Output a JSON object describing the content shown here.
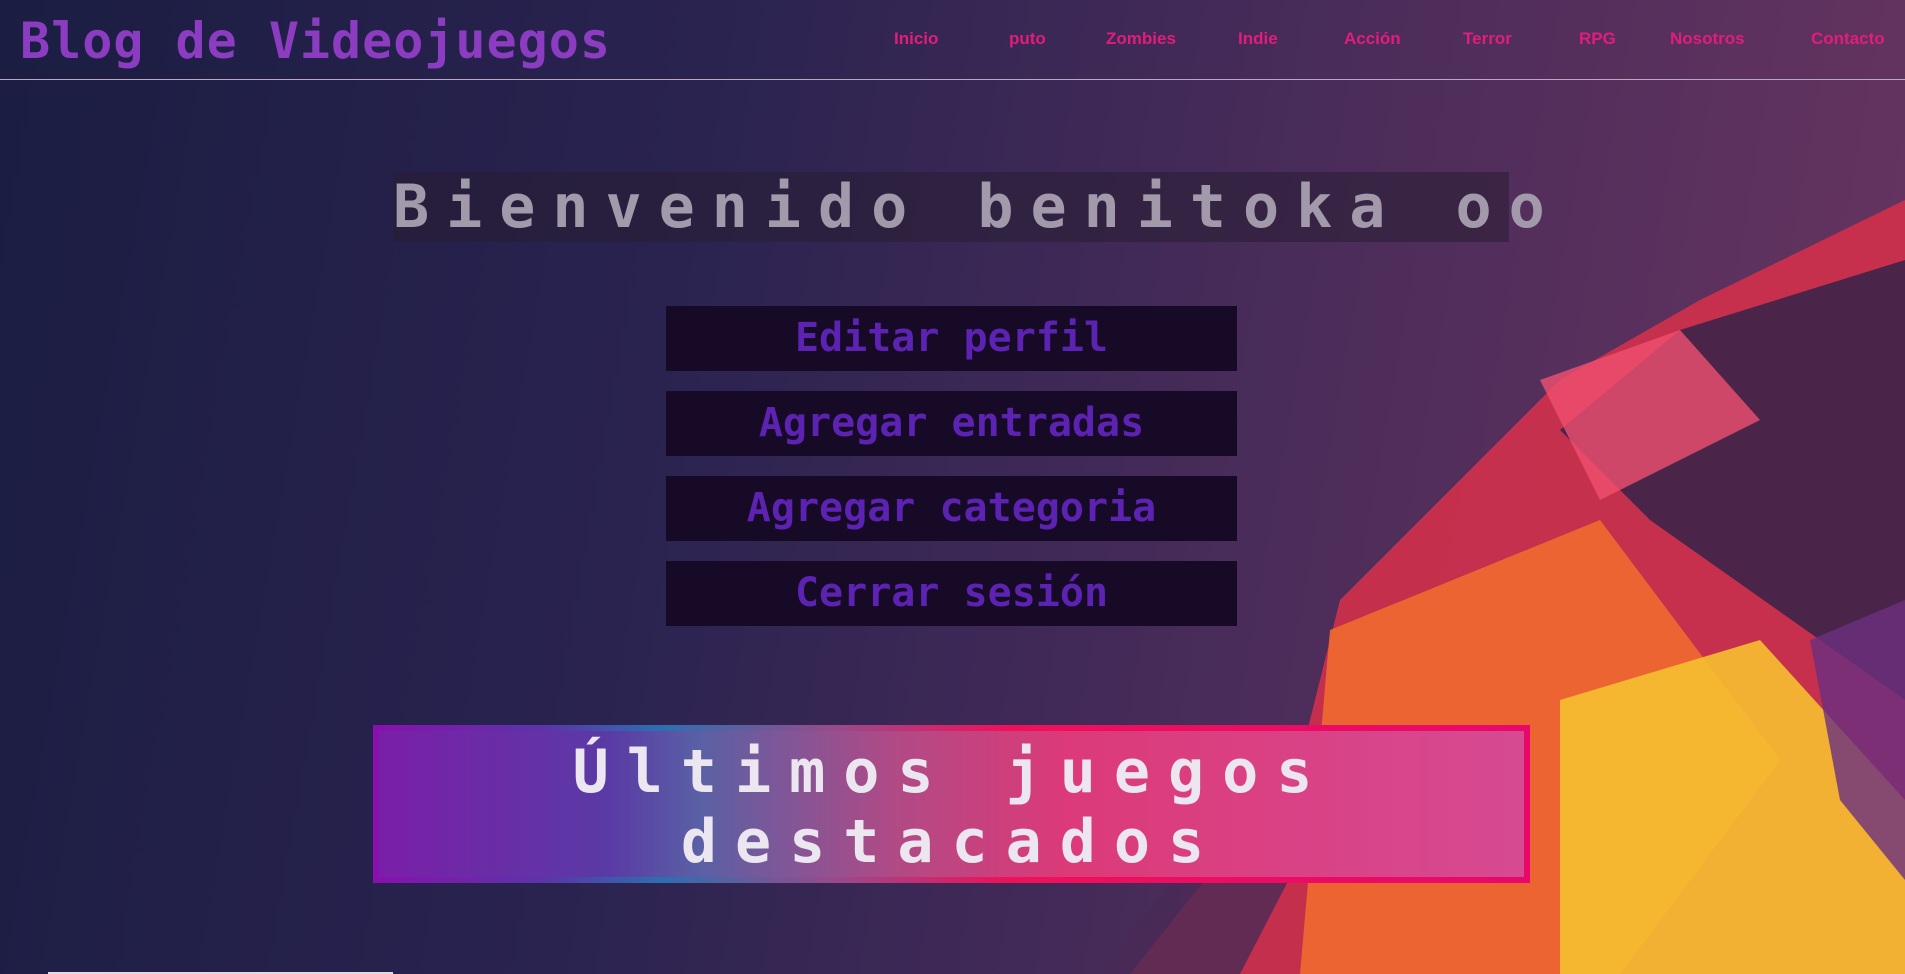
{
  "header": {
    "title": "Blog de Videojuegos",
    "nav": [
      "Inicio",
      "puto",
      "Zombies",
      "Indie",
      "Acción",
      "Terror",
      "RPG",
      "Nosotros",
      "Contacto"
    ]
  },
  "main": {
    "welcome": "Bienvenido benitoka oo",
    "buttons": [
      "Editar perfil",
      "Agregar entradas",
      "Agregar categoria",
      "Cerrar sesión"
    ],
    "featured_title": "Últimos juegos destacados"
  },
  "colors": {
    "accent": "#e21c7a",
    "logo": "#8c3cc0",
    "button_text": "#5c22b2"
  }
}
